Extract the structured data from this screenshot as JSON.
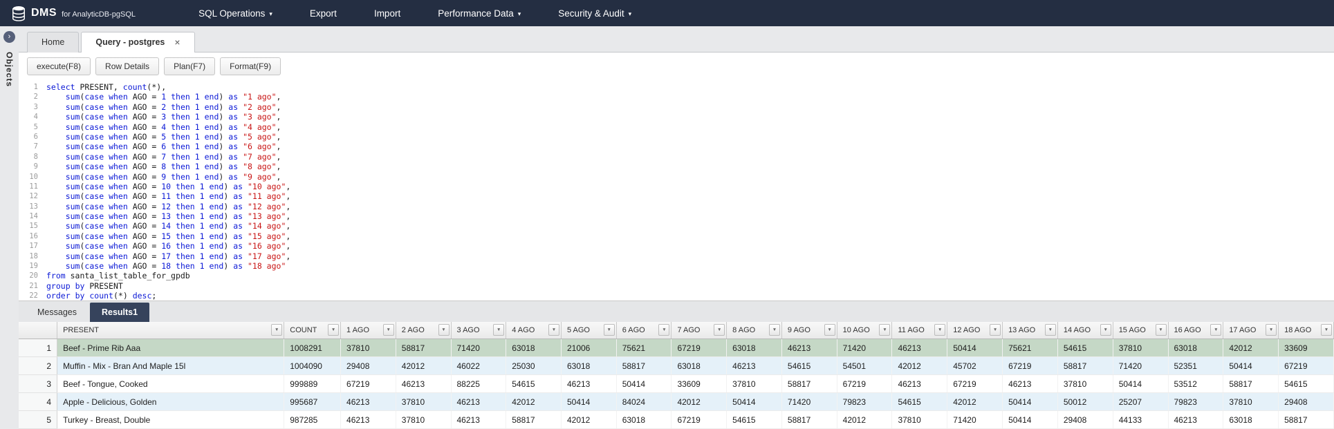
{
  "colors": {
    "nav_bg": "#242e42",
    "results_active_tab": "#36435c",
    "selected_row": "#c5d8c6",
    "alt_row": "#e5f1f9",
    "sql_keyword": "#0a18d6",
    "sql_string": "#c81414"
  },
  "nav": {
    "brand": "DMS",
    "brand_suffix": "for AnalyticDB-pgSQL",
    "items": [
      {
        "label": "SQL Operations",
        "has_caret": true
      },
      {
        "label": "Export",
        "has_caret": false
      },
      {
        "label": "Import",
        "has_caret": false
      },
      {
        "label": "Performance Data",
        "has_caret": true
      },
      {
        "label": "Security & Audit",
        "has_caret": true
      }
    ]
  },
  "sidebar": {
    "label": "Objects",
    "expand_icon": "›"
  },
  "tabs": [
    {
      "label": "Home",
      "active": false,
      "closable": false
    },
    {
      "label": "Query - postgres",
      "active": true,
      "closable": true
    }
  ],
  "toolbar": {
    "buttons": [
      "execute(F8)",
      "Row Details",
      "Plan(F7)",
      "Format(F9)"
    ]
  },
  "editor": {
    "sql_lines": [
      "select PRESENT, count(*),",
      "    sum(case when AGO = 1 then 1 end) as \"1 ago\",",
      "    sum(case when AGO = 2 then 1 end) as \"2 ago\",",
      "    sum(case when AGO = 3 then 1 end) as \"3 ago\",",
      "    sum(case when AGO = 4 then 1 end) as \"4 ago\",",
      "    sum(case when AGO = 5 then 1 end) as \"5 ago\",",
      "    sum(case when AGO = 6 then 1 end) as \"6 ago\",",
      "    sum(case when AGO = 7 then 1 end) as \"7 ago\",",
      "    sum(case when AGO = 8 then 1 end) as \"8 ago\",",
      "    sum(case when AGO = 9 then 1 end) as \"9 ago\",",
      "    sum(case when AGO = 10 then 1 end) as \"10 ago\",",
      "    sum(case when AGO = 11 then 1 end) as \"11 ago\",",
      "    sum(case when AGO = 12 then 1 end) as \"12 ago\",",
      "    sum(case when AGO = 13 then 1 end) as \"13 ago\",",
      "    sum(case when AGO = 14 then 1 end) as \"14 ago\",",
      "    sum(case when AGO = 15 then 1 end) as \"15 ago\",",
      "    sum(case when AGO = 16 then 1 end) as \"16 ago\",",
      "    sum(case when AGO = 17 then 1 end) as \"17 ago\",",
      "    sum(case when AGO = 18 then 1 end) as \"18 ago\"",
      "from santa_list_table_for_gpdb",
      "group by PRESENT",
      "order by count(*) desc;"
    ]
  },
  "results": {
    "tabs": [
      {
        "label": "Messages",
        "active": false
      },
      {
        "label": "Results1",
        "active": true
      }
    ],
    "columns": [
      "PRESENT",
      "COUNT",
      "1 AGO",
      "2 AGO",
      "3 AGO",
      "4 AGO",
      "5 AGO",
      "6 AGO",
      "7 AGO",
      "8 AGO",
      "9 AGO",
      "10 AGO",
      "11 AGO",
      "12 AGO",
      "13 AGO",
      "14 AGO",
      "15 AGO",
      "16 AGO",
      "17 AGO",
      "18 AGO"
    ],
    "rows": [
      {
        "num": 1,
        "present": "Beef - Prime Rib Aaa",
        "selected": true,
        "values": [
          1008291,
          37810,
          58817,
          71420,
          63018,
          21006,
          75621,
          67219,
          63018,
          46213,
          71420,
          46213,
          50414,
          75621,
          54615,
          37810,
          63018,
          42012,
          33609
        ]
      },
      {
        "num": 2,
        "present": "Muffin - Mix - Bran And Maple 15l",
        "selected": false,
        "values": [
          1004090,
          29408,
          42012,
          46022,
          25030,
          63018,
          58817,
          63018,
          46213,
          54615,
          54501,
          42012,
          45702,
          67219,
          58817,
          71420,
          52351,
          50414,
          67219
        ]
      },
      {
        "num": 3,
        "present": "Beef - Tongue, Cooked",
        "selected": false,
        "values": [
          999889,
          67219,
          46213,
          88225,
          54615,
          46213,
          50414,
          33609,
          37810,
          58817,
          67219,
          46213,
          67219,
          46213,
          37810,
          50414,
          53512,
          58817,
          54615
        ]
      },
      {
        "num": 4,
        "present": "Apple - Delicious, Golden",
        "selected": false,
        "values": [
          995687,
          46213,
          37810,
          46213,
          42012,
          50414,
          84024,
          42012,
          50414,
          71420,
          79823,
          54615,
          42012,
          50414,
          50012,
          25207,
          79823,
          37810,
          29408
        ]
      },
      {
        "num": 5,
        "present": "Turkey - Breast, Double",
        "selected": false,
        "values": [
          987285,
          46213,
          37810,
          46213,
          58817,
          42012,
          63018,
          67219,
          54615,
          58817,
          42012,
          37810,
          71420,
          50414,
          29408,
          44133,
          46213,
          63018,
          58817
        ]
      }
    ]
  }
}
